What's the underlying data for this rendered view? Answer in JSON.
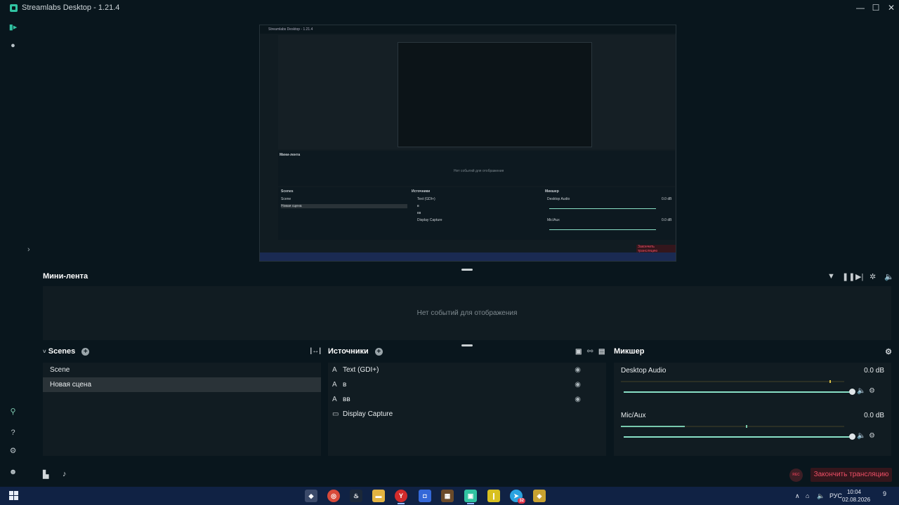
{
  "window": {
    "title": "Streamlabs Desktop - 1.21.4",
    "controls": [
      "—",
      "☐",
      "✕"
    ]
  },
  "preview_thumbnail": {
    "title": "Streamlabs Desktop - 1.21.4",
    "minifeed_label": "Мини-лента",
    "empty_text": "Нет событий для отображения",
    "scenes_label": "Scenes",
    "sources_label": "Источники",
    "mixer_label": "Микшер",
    "scene_1": "Scene",
    "scene_2": "Новая сцена",
    "source_1": "Text (GDI+)",
    "source_2": "в",
    "source_3": "вв",
    "source_4": "Display Capture",
    "mix_1": "Desktop Audio",
    "mix_2": "Mic/Aux",
    "db": "0.0 dB",
    "stop": "Закончить трансляцию"
  },
  "minifeed": {
    "title": "Мини-лента",
    "empty_text": "Нет событий для отображения"
  },
  "scenes": {
    "title": "Scenes",
    "items": [
      {
        "label": "Scene",
        "selected": false
      },
      {
        "label": "Новая сцена",
        "selected": true
      }
    ]
  },
  "sources": {
    "title": "Источники",
    "items": [
      {
        "label": "Text (GDI+)",
        "icon": "text-icon"
      },
      {
        "label": "в",
        "icon": "text-icon"
      },
      {
        "label": "вв",
        "icon": "text-icon"
      },
      {
        "label": "Display Capture",
        "icon": "monitor-icon"
      }
    ]
  },
  "mixer": {
    "title": "Микшер",
    "channels": [
      {
        "name": "Desktop Audio",
        "db": "0.0 dB",
        "volume": 1.0
      },
      {
        "name": "Mic/Aux",
        "db": "0.0 dB",
        "volume": 1.0
      }
    ]
  },
  "footer": {
    "rec_label": "REC",
    "stop_stream": "Закончить трансляцию"
  },
  "taskbar": {
    "lang": "РУС",
    "time": "10:04",
    "date": "02.08.2026",
    "notif_count": "9",
    "telegram_badge": "32"
  },
  "colors": {
    "accent": "#31c3a2",
    "fader": "#89e0c6",
    "stop_text": "#ef4f66",
    "taskbar": "#102244"
  }
}
